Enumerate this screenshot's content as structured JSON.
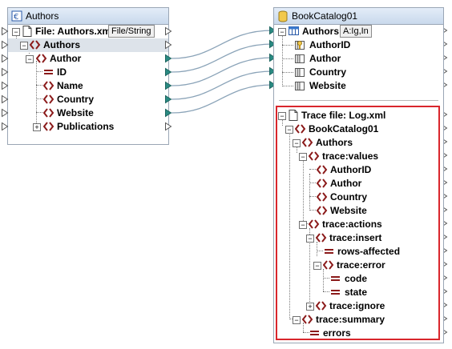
{
  "authors_component": {
    "title": "Authors",
    "file_label": "File: Authors.xml",
    "file_button": "File/String",
    "tree": [
      {
        "label": "Authors",
        "icon": "element-icon"
      },
      {
        "label": "Author",
        "icon": "element-icon"
      },
      {
        "label": "ID",
        "icon": "attribute-icon"
      },
      {
        "label": "Name",
        "icon": "element-icon"
      },
      {
        "label": "Country",
        "icon": "element-icon"
      },
      {
        "label": "Website",
        "icon": "element-icon"
      },
      {
        "label": "Publications",
        "icon": "element-icon"
      }
    ]
  },
  "db_component": {
    "title": "BookCatalog01",
    "table_label": "Authors",
    "table_button": "A:Ig,In",
    "columns": [
      "AuthorID",
      "Author",
      "Country",
      "Website"
    ],
    "trace_file": "Trace file: Log.xml",
    "trace_tree": {
      "root": "BookCatalog01",
      "authors": "Authors",
      "values": "trace:values",
      "value_items": [
        "AuthorID",
        "Author",
        "Country",
        "Website"
      ],
      "actions": "trace:actions",
      "insert": "trace:insert",
      "rows_affected": "rows-affected",
      "error": "trace:error",
      "code": "code",
      "state": "state",
      "ignore": "trace:ignore",
      "summary": "trace:summary",
      "errors": "errors"
    }
  },
  "colors": {
    "connector": "#8aa3b8",
    "connector_arrow": "#2a8a82",
    "highlight_box": "#d9262c",
    "element_icon": "#8b1a1a"
  }
}
